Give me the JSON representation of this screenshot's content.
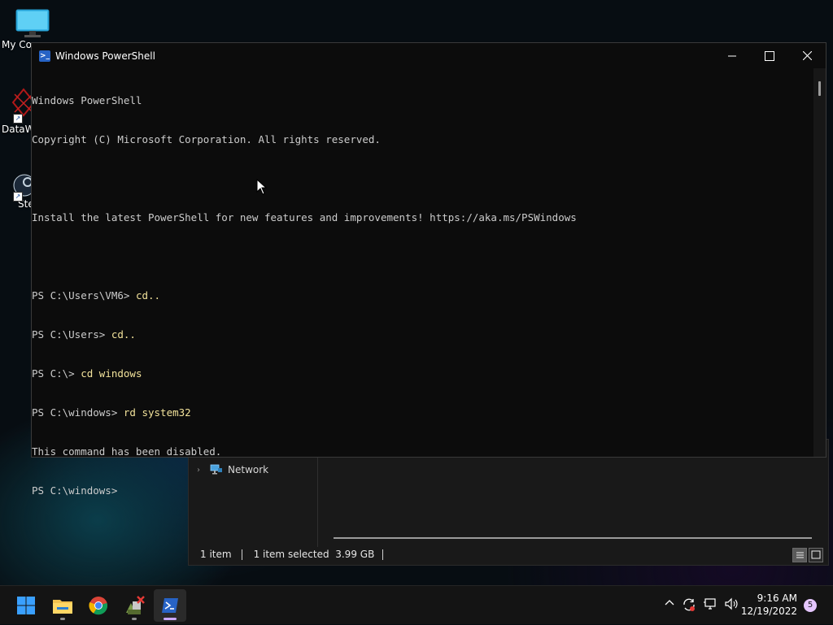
{
  "desktop": {
    "icons": [
      {
        "label": "My Co",
        "icon": "computer-icon"
      },
      {
        "label": "DataW",
        "icon": "datawarehouse-icon"
      },
      {
        "label": "Ste",
        "icon": "steam-icon"
      }
    ]
  },
  "explorer": {
    "nav_item": "Network",
    "status": {
      "items": "1 item",
      "selected": "1 item selected",
      "size": "3.99 GB"
    }
  },
  "powershell": {
    "title": "Windows PowerShell",
    "console": {
      "lines": [
        {
          "prompt": "Windows PowerShell",
          "cmd": ""
        },
        {
          "prompt": "Copyright (C) Microsoft Corporation. All rights reserved.",
          "cmd": ""
        },
        {
          "prompt": "",
          "cmd": ""
        },
        {
          "prompt": "Install the latest PowerShell for new features and improvements! https://aka.ms/PSWindows",
          "cmd": ""
        },
        {
          "prompt": "",
          "cmd": ""
        },
        {
          "prompt": "PS C:\\Users\\VM6> ",
          "cmd": "cd.."
        },
        {
          "prompt": "PS C:\\Users> ",
          "cmd": "cd.."
        },
        {
          "prompt": "PS C:\\> ",
          "cmd": "cd windows"
        },
        {
          "prompt": "PS C:\\windows> ",
          "cmd": "rd system32"
        },
        {
          "prompt": "This command has been disabled.",
          "cmd": ""
        },
        {
          "prompt": "PS C:\\windows>",
          "cmd": ""
        }
      ]
    }
  },
  "taskbar": {
    "apps": [
      {
        "name": "start",
        "icon": "windows-start-icon"
      },
      {
        "name": "file-explorer",
        "icon": "folder-icon"
      },
      {
        "name": "chrome",
        "icon": "chrome-icon"
      },
      {
        "name": "app",
        "icon": "app-icon"
      },
      {
        "name": "powershell",
        "icon": "powershell-icon",
        "active": true
      }
    ],
    "clock": {
      "time": "9:16 AM",
      "date": "12/19/2022"
    },
    "notification_count": "5"
  },
  "colors": {
    "console_bg": "#0c0c0c",
    "console_text": "#cccccc",
    "command_text": "#f2e29b",
    "taskbar_bg": "#141414",
    "ps_blue": "#2763c5"
  }
}
